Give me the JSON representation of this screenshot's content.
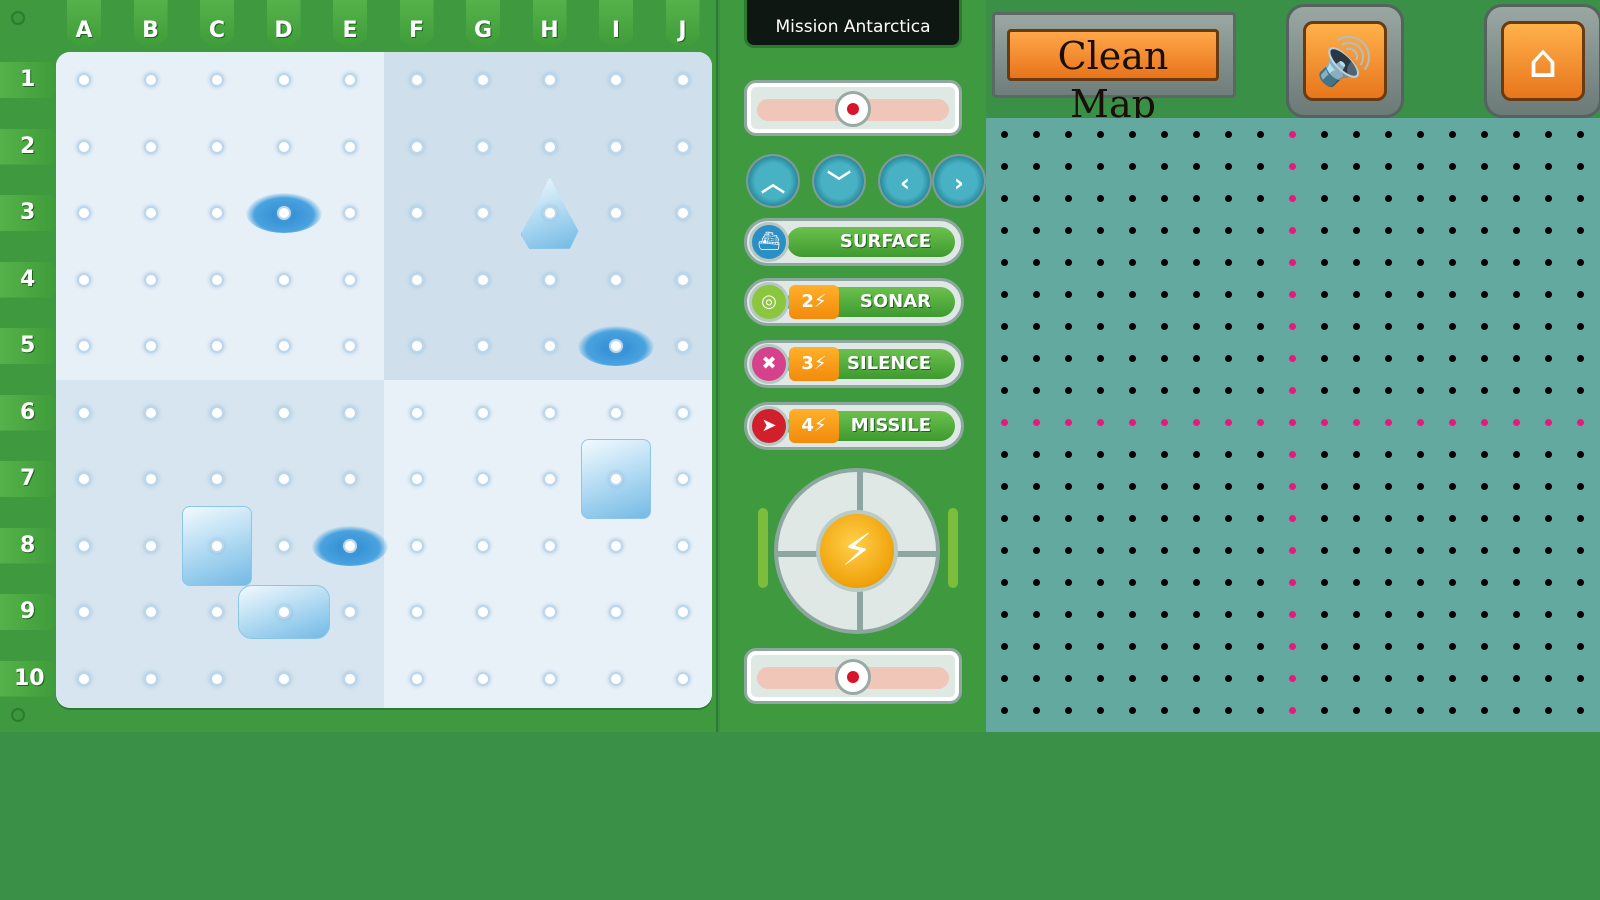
{
  "board": {
    "columns": [
      "A",
      "B",
      "C",
      "D",
      "E",
      "F",
      "G",
      "H",
      "I",
      "J"
    ],
    "rows": [
      "1",
      "2",
      "3",
      "4",
      "5",
      "6",
      "7",
      "8",
      "9",
      "10"
    ],
    "islands_rock": [
      {
        "col": "D",
        "row": "3"
      },
      {
        "col": "I",
        "row": "5"
      },
      {
        "col": "E",
        "row": "8"
      }
    ],
    "icebergs": [
      {
        "col": "H",
        "row": "3",
        "type": "spire"
      },
      {
        "col": "I",
        "row": "7",
        "type": "block"
      },
      {
        "col": "C",
        "row": "8",
        "type": "block"
      },
      {
        "col": "D",
        "row": "9",
        "type": "flat"
      }
    ]
  },
  "control_panel": {
    "mission_title": "Mission Antarctica",
    "nav": {
      "up_icon": "chevron-up-icon",
      "down_icon": "chevron-down-icon",
      "left_icon": "chevron-left-icon",
      "right_icon": "chevron-right-icon"
    },
    "powers": [
      {
        "key": "surface",
        "label": "SURFACE",
        "cost": "",
        "icon": "submarine-icon",
        "color": "#2b8fc4"
      },
      {
        "key": "sonar",
        "label": "SONAR",
        "cost": "2⚡",
        "icon": "radar-icon",
        "color": "#8bc63f"
      },
      {
        "key": "silence",
        "label": "SILENCE",
        "cost": "3⚡",
        "icon": "silence-icon",
        "color": "#d6418c"
      },
      {
        "key": "missile",
        "label": "MISSILE",
        "cost": "4⚡",
        "icon": "missile-icon",
        "color": "#d21f2c"
      }
    ],
    "launch_icon": "lightning-icon"
  },
  "toolbar": {
    "clean_map_label": "Clean Map",
    "sound_icon": "speaker-icon",
    "home_icon": "home-icon"
  },
  "track_pad": {
    "dot_rows": 19,
    "dot_cols": 19,
    "highlight_col_index": 9,
    "highlight_row_index": 9,
    "dot_color": "#000000",
    "highlight_color": "#e8197a"
  },
  "colors": {
    "panel_green": "#3f9a3f",
    "pad_teal": "#64a9a0",
    "accent_orange": "#f28a0c"
  }
}
